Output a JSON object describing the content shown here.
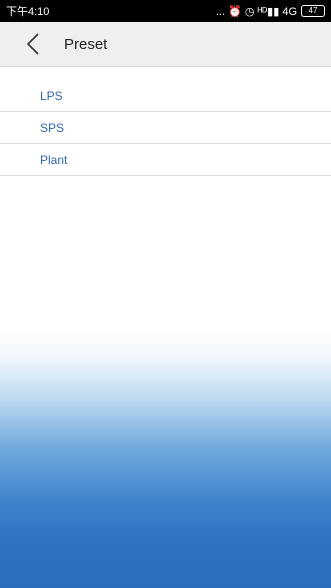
{
  "status_bar": {
    "time": "下午4:10",
    "indicators": "... ⏰ ◷ ᴴᴰ▮▮ 4G",
    "battery": "47"
  },
  "header": {
    "back_icon": "chevron-left-icon",
    "title": "Preset"
  },
  "preset_list": {
    "items": [
      {
        "label": "LPS"
      },
      {
        "label": "SPS"
      },
      {
        "label": "Plant"
      }
    ]
  }
}
